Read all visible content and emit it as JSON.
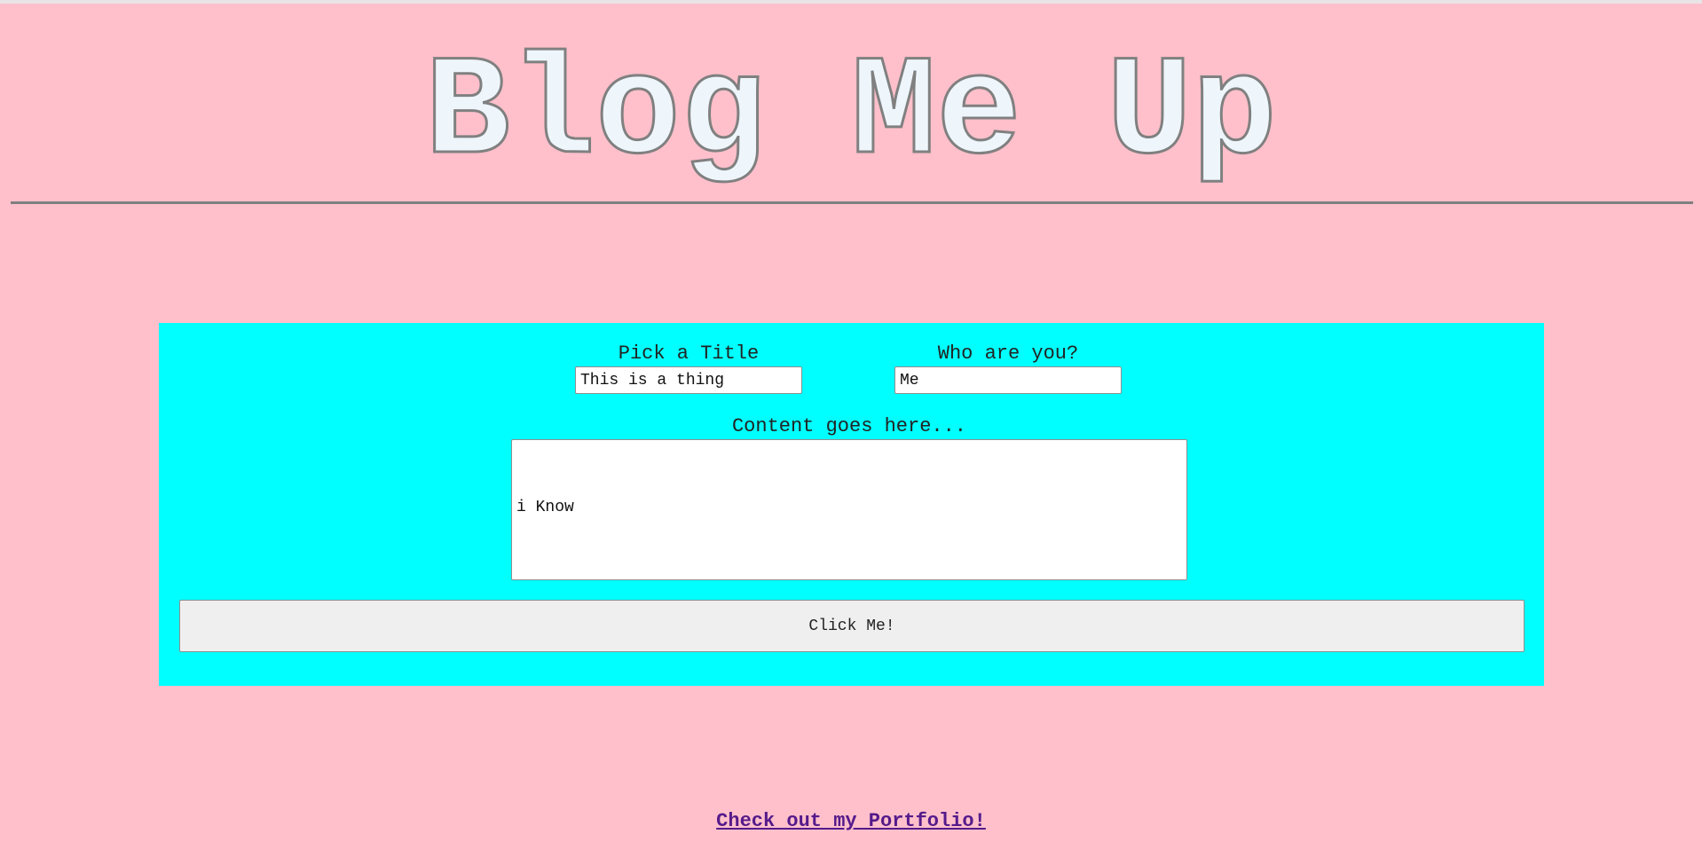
{
  "header": {
    "title": "Blog Me Up"
  },
  "form": {
    "title_label": "Pick a Title",
    "title_value": "This is a thing",
    "author_label": "Who are you?",
    "author_value": "Me",
    "content_label": "Content goes here...",
    "content_value": "i Know",
    "submit_label": "Click Me!"
  },
  "footer": {
    "link_text": "Check out my Portfolio!"
  },
  "colors": {
    "page_background": "#ffc0cb",
    "panel_background": "#00ffff",
    "title_fill": "#eef6fc",
    "title_outline": "#808080",
    "link": "#551a8b"
  }
}
